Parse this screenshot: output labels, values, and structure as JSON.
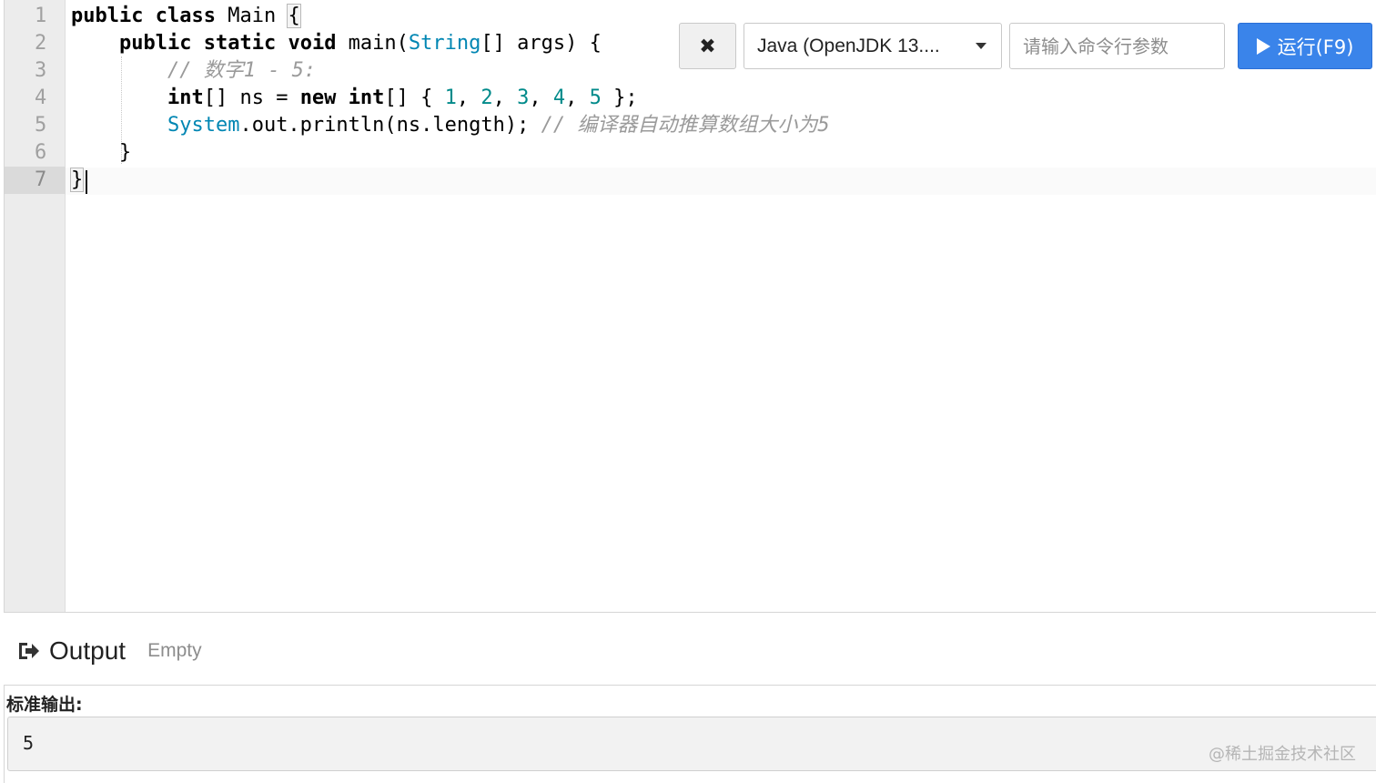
{
  "editor": {
    "line_numbers": [
      "1",
      "2",
      "3",
      "4",
      "5",
      "6",
      "7"
    ],
    "active_line": 7,
    "lines": [
      [
        {
          "t": "kw",
          "v": "public"
        },
        {
          "t": "plain",
          "v": " "
        },
        {
          "t": "kw",
          "v": "class"
        },
        {
          "t": "plain",
          "v": " Main "
        },
        {
          "t": "bracket",
          "v": "{"
        }
      ],
      [
        {
          "t": "plain",
          "v": "    "
        },
        {
          "t": "kw",
          "v": "public"
        },
        {
          "t": "plain",
          "v": " "
        },
        {
          "t": "kw",
          "v": "static"
        },
        {
          "t": "plain",
          "v": " "
        },
        {
          "t": "kw",
          "v": "void"
        },
        {
          "t": "plain",
          "v": " main("
        },
        {
          "t": "type",
          "v": "String"
        },
        {
          "t": "plain",
          "v": "[] args) {"
        }
      ],
      [
        {
          "t": "plain",
          "v": "        "
        },
        {
          "t": "cmt",
          "v": "// 数字1 - 5:"
        }
      ],
      [
        {
          "t": "plain",
          "v": "        "
        },
        {
          "t": "kw",
          "v": "int"
        },
        {
          "t": "plain",
          "v": "[] ns = "
        },
        {
          "t": "kw",
          "v": "new"
        },
        {
          "t": "plain",
          "v": " "
        },
        {
          "t": "kw",
          "v": "int"
        },
        {
          "t": "plain",
          "v": "[] { "
        },
        {
          "t": "num",
          "v": "1"
        },
        {
          "t": "plain",
          "v": ", "
        },
        {
          "t": "num",
          "v": "2"
        },
        {
          "t": "plain",
          "v": ", "
        },
        {
          "t": "num",
          "v": "3"
        },
        {
          "t": "plain",
          "v": ", "
        },
        {
          "t": "num",
          "v": "4"
        },
        {
          "t": "plain",
          "v": ", "
        },
        {
          "t": "num",
          "v": "5"
        },
        {
          "t": "plain",
          "v": " };"
        }
      ],
      [
        {
          "t": "plain",
          "v": "        "
        },
        {
          "t": "type",
          "v": "System"
        },
        {
          "t": "plain",
          "v": ".out.println(ns.length); "
        },
        {
          "t": "cmt",
          "v": "// 编译器自动推算数组大小为5"
        }
      ],
      [
        {
          "t": "plain",
          "v": "    }"
        }
      ],
      [
        {
          "t": "bracket",
          "v": "}"
        }
      ]
    ]
  },
  "toolbar": {
    "clear_label": "✖",
    "language_selected": "Java (OpenJDK 13....",
    "args_placeholder": "请输入命令行参数",
    "args_value": "",
    "run_label": "运行(F9)"
  },
  "output": {
    "title": "Output",
    "status": "Empty",
    "stdout_label": "标准输出:",
    "stdout_value": "5"
  },
  "watermark": "@稀土掘金技术社区",
  "colors": {
    "run_button": "#3a84ea",
    "type_token": "#0086b3",
    "number_token": "#008a8a",
    "comment_token": "#9a9a9a",
    "gutter_bg": "#ececec"
  },
  "icons": {
    "clear": "x-mark-icon",
    "dropdown": "caret-down-icon",
    "run": "play-icon",
    "output": "sign-out-icon"
  }
}
